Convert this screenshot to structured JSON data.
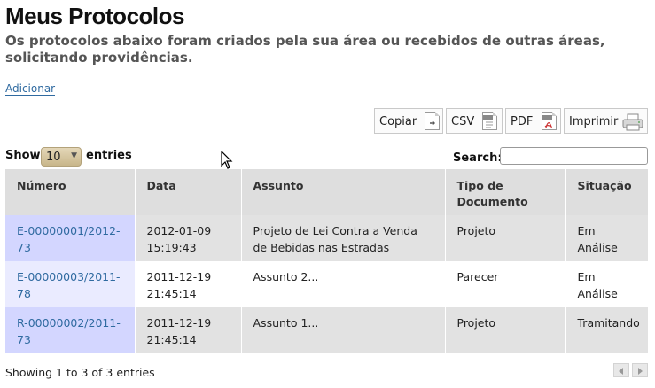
{
  "page": {
    "title": "Meus Protocolos",
    "subtitle": "Os protocolos abaixo foram criados pela sua área ou recebidos de outras áreas, solicitando providências.",
    "add_link": "Adicionar"
  },
  "toolbar": {
    "copy_label": "Copiar",
    "csv_label": "CSV",
    "pdf_label": "PDF",
    "print_label": "Imprimir"
  },
  "length": {
    "show_label": "Show",
    "value": "10",
    "entries_label": "entries"
  },
  "search": {
    "label": "Search:",
    "value": ""
  },
  "table": {
    "headers": [
      "Número",
      "Data",
      "Assunto",
      "Tipo de Documento",
      "Situação"
    ],
    "rows": [
      {
        "numero": "E-00000001/2012-73",
        "data": "2012-01-09 15:19:43",
        "assunto": "Projeto de Lei Contra a Venda de Bebidas nas Estradas",
        "tipo": "Projeto",
        "situacao": "Em Análise"
      },
      {
        "numero": "E-00000003/2011-78",
        "data": "2011-12-19 21:45:14",
        "assunto": "Assunto 2...",
        "tipo": "Parecer",
        "situacao": "Em Análise"
      },
      {
        "numero": "R-00000002/2011-73",
        "data": "2011-12-19 21:45:14",
        "assunto": "Assunto 1...",
        "tipo": "Projeto",
        "situacao": "Tramitando"
      }
    ]
  },
  "footer": {
    "info": "Showing 1 to 3 of 3 entries"
  },
  "icons": {
    "copy": "copy-document-icon",
    "csv": "csv-document-icon",
    "pdf": "pdf-document-icon",
    "print": "printer-icon",
    "prev": "previous-arrow-icon",
    "next": "next-arrow-icon"
  },
  "colors": {
    "link": "#2f6aa0",
    "header_bg": "#dedede",
    "sorted_col": "#d3d6ff"
  }
}
